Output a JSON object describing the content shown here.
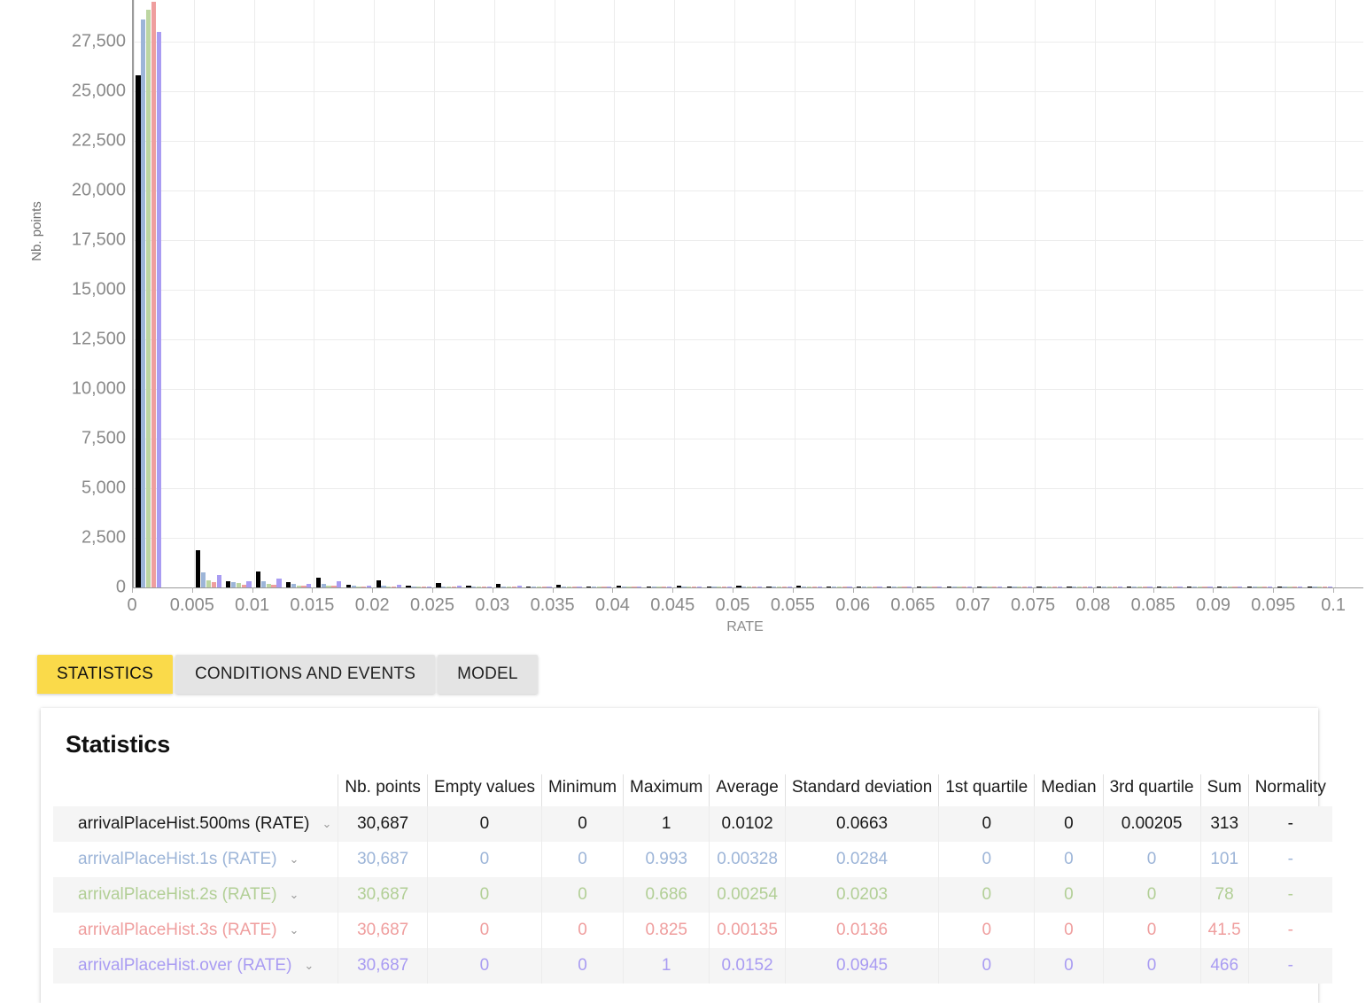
{
  "chart_data": {
    "type": "bar",
    "title": "",
    "xlabel": "RATE",
    "ylabel": "Nb. points",
    "xlim": [
      0,
      0.1025
    ],
    "ylim": [
      0,
      29600
    ],
    "grid": true,
    "legend_position": "none",
    "bin_width": 0.0025,
    "y_ticks": [
      0,
      2500,
      5000,
      7500,
      10000,
      12500,
      15000,
      17500,
      20000,
      22500,
      25000,
      27500
    ],
    "y_tick_labels": [
      "0",
      "2,500",
      "5,000",
      "7,500",
      "10,000",
      "12,500",
      "15,000",
      "17,500",
      "20,000",
      "22,500",
      "25,000",
      "27,500"
    ],
    "x_ticks": [
      0,
      0.005,
      0.01,
      0.015,
      0.02,
      0.025,
      0.03,
      0.035,
      0.04,
      0.045,
      0.05,
      0.055,
      0.06,
      0.065,
      0.07,
      0.075,
      0.08,
      0.085,
      0.09,
      0.095,
      0.1
    ],
    "x_tick_labels": [
      "0",
      "0.005",
      "0.01",
      "0.015",
      "0.02",
      "0.025",
      "0.03",
      "0.035",
      "0.04",
      "0.045",
      "0.05",
      "0.055",
      "0.06",
      "0.065",
      "0.07",
      "0.075",
      "0.08",
      "0.085",
      "0.09",
      "0.095",
      "0.1"
    ],
    "bin_centers": [
      0.00125,
      0.00375,
      0.00625,
      0.00875,
      0.01125,
      0.01375,
      0.01625,
      0.01875,
      0.02125,
      0.02375,
      0.02625,
      0.02875,
      0.03125,
      0.03375,
      0.03625,
      0.03875,
      0.04125,
      0.04375,
      0.04625,
      0.04875,
      0.05125,
      0.05375,
      0.05625,
      0.05875,
      0.06125,
      0.06375,
      0.06625,
      0.06875,
      0.07125,
      0.07375,
      0.07625,
      0.07875,
      0.08125,
      0.08375,
      0.08625,
      0.08875,
      0.09125,
      0.09375,
      0.09625,
      0.09875
    ],
    "series": [
      {
        "name": "arrivalPlaceHist.500ms (RATE)",
        "color": "#000000",
        "values": [
          25800,
          0,
          1880,
          330,
          790,
          270,
          510,
          120,
          360,
          90,
          230,
          70,
          170,
          60,
          135,
          50,
          110,
          45,
          95,
          40,
          80,
          35,
          70,
          30,
          62,
          28,
          55,
          25,
          50,
          22,
          45,
          20,
          40,
          18,
          36,
          16,
          32,
          15,
          28,
          13
        ]
      },
      {
        "name": "arrivalPlaceHist.1s (RATE)",
        "color": "#9db5d8",
        "values": [
          28600,
          0,
          740,
          250,
          300,
          160,
          180,
          80,
          90,
          55,
          60,
          40,
          45,
          32,
          36,
          26,
          30,
          22,
          26,
          19,
          22,
          16,
          19,
          14,
          17,
          12,
          15,
          11,
          13,
          10,
          12,
          9,
          11,
          8,
          10,
          8,
          9,
          7,
          8,
          6
        ]
      },
      {
        "name": "arrivalPlaceHist.2s (RATE)",
        "color": "#bdd6a2",
        "values": [
          29100,
          0,
          380,
          210,
          160,
          110,
          110,
          60,
          60,
          40,
          42,
          30,
          32,
          24,
          26,
          20,
          22,
          17,
          19,
          15,
          17,
          13,
          15,
          12,
          13,
          11,
          12,
          10,
          11,
          9,
          10,
          8,
          9,
          7,
          8,
          7,
          8,
          6,
          7,
          5
        ]
      },
      {
        "name": "arrivalPlaceHist.3s (RATE)",
        "color": "#ef9e9e",
        "values": [
          29500,
          0,
          250,
          140,
          120,
          80,
          70,
          45,
          45,
          30,
          32,
          24,
          25,
          19,
          20,
          16,
          17,
          14,
          15,
          12,
          14,
          11,
          12,
          10,
          11,
          9,
          10,
          8,
          9,
          8,
          8,
          7,
          8,
          6,
          7,
          6,
          6,
          5,
          6,
          4
        ]
      },
      {
        "name": "arrivalPlaceHist.over (RATE)",
        "color": "#a99cf2",
        "values": [
          28000,
          0,
          620,
          330,
          430,
          190,
          300,
          100,
          150,
          65,
          95,
          48,
          70,
          38,
          55,
          30,
          46,
          26,
          40,
          23,
          35,
          20,
          31,
          18,
          28,
          16,
          25,
          15,
          23,
          14,
          21,
          13,
          19,
          12,
          18,
          11,
          16,
          10,
          15,
          9
        ]
      }
    ]
  },
  "tabs": [
    {
      "label": "STATISTICS",
      "active": true
    },
    {
      "label": "CONDITIONS AND EVENTS",
      "active": false
    },
    {
      "label": "MODEL",
      "active": false
    }
  ],
  "statistics": {
    "title": "Statistics",
    "columns": [
      "",
      "Nb. points",
      "Empty values",
      "Minimum",
      "Maximum",
      "Average",
      "Standard deviation",
      "1st quartile",
      "Median",
      "3rd quartile",
      "Sum",
      "Normality"
    ],
    "chevron": "⌄",
    "rows": [
      {
        "name": "arrivalPlaceHist.500ms (RATE)",
        "color": "#1a1a1a",
        "nb_points": "30,687",
        "empty_values": "0",
        "minimum": "0",
        "maximum": "1",
        "average": "0.0102",
        "standard_deviation": "0.0663",
        "q1": "0",
        "median": "0",
        "q3": "0.00205",
        "sum": "313",
        "normality": "-"
      },
      {
        "name": "arrivalPlaceHist.1s (RATE)",
        "color": "#9db5d8",
        "nb_points": "30,687",
        "empty_values": "0",
        "minimum": "0",
        "maximum": "0.993",
        "average": "0.00328",
        "standard_deviation": "0.0284",
        "q1": "0",
        "median": "0",
        "q3": "0",
        "sum": "101",
        "normality": "-"
      },
      {
        "name": "arrivalPlaceHist.2s (RATE)",
        "color": "#b2cf96",
        "nb_points": "30,687",
        "empty_values": "0",
        "minimum": "0",
        "maximum": "0.686",
        "average": "0.00254",
        "standard_deviation": "0.0203",
        "q1": "0",
        "median": "0",
        "q3": "0",
        "sum": "78",
        "normality": "-"
      },
      {
        "name": "arrivalPlaceHist.3s (RATE)",
        "color": "#ef9e9e",
        "nb_points": "30,687",
        "empty_values": "0",
        "minimum": "0",
        "maximum": "0.825",
        "average": "0.00135",
        "standard_deviation": "0.0136",
        "q1": "0",
        "median": "0",
        "q3": "0",
        "sum": "41.5",
        "normality": "-"
      },
      {
        "name": "arrivalPlaceHist.over (RATE)",
        "color": "#a99cf2",
        "nb_points": "30,687",
        "empty_values": "0",
        "minimum": "0",
        "maximum": "1",
        "average": "0.0152",
        "standard_deviation": "0.0945",
        "q1": "0",
        "median": "0",
        "q3": "0",
        "sum": "466",
        "normality": "-"
      }
    ]
  }
}
